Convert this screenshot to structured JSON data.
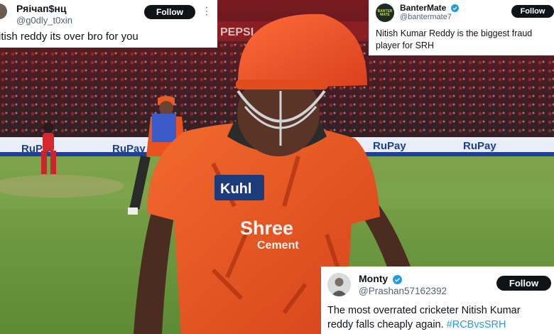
{
  "tweets": [
    {
      "display_name": "Ряічап$нц",
      "handle": "@g0dly_t0xin",
      "follow_label": "Follow",
      "text": "itish reddy its over bro for you"
    },
    {
      "display_name": "BanterMate",
      "handle": "@bantermate7",
      "follow_label": "Follow",
      "avatar_text": "BANTER MATE",
      "text_line1": "Nitish Kumar Reddy is the biggest fraud",
      "text_line2": "player for SRH"
    },
    {
      "display_name": "Monty",
      "handle": "@Prashan57162392",
      "follow_label": "Follow",
      "text_line1": "The most overrated cricketer Nitish Kumar",
      "text_line2_plain": "reddy falls cheaply again. ",
      "hashtag": "#RCBvsSRH"
    }
  ],
  "scene": {
    "jersey_sponsor_1": "Kuhl",
    "jersey_sponsor_2_line1": "Shree",
    "jersey_sponsor_2_line2": "Cement",
    "board_logo": "RuPay",
    "stand_sign": "PEPSI"
  },
  "colors": {
    "pitch": "#6f9a43",
    "jersey": "#e8501e",
    "verified": "#1d9bf0",
    "follow_bg": "#0f1419"
  }
}
